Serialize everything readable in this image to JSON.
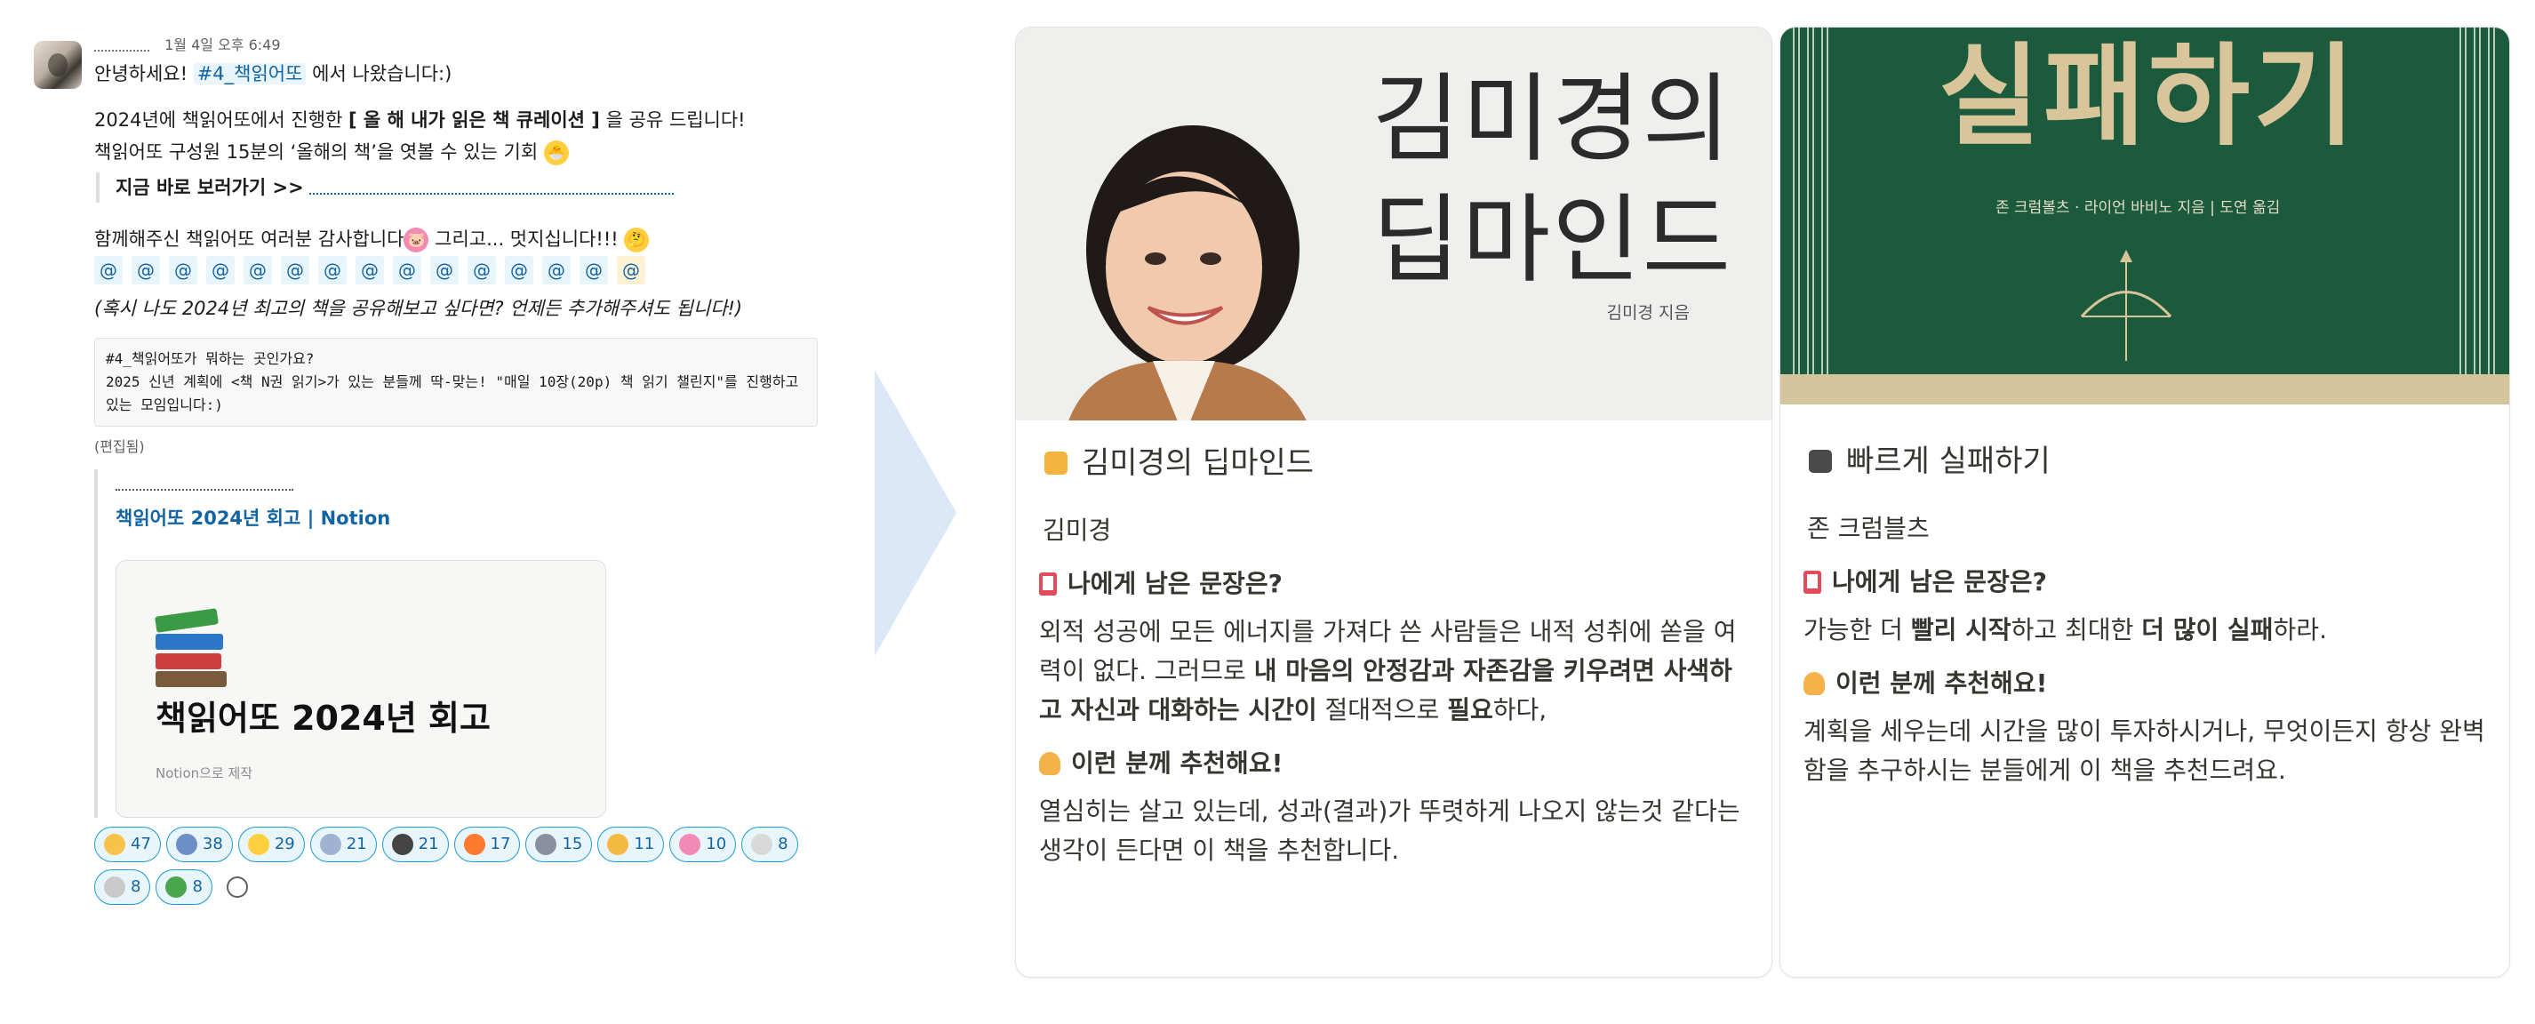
{
  "message": {
    "timestamp": "1월 4일 오후 6:49",
    "line1_pre": "안녕하세요! ",
    "line1_channel": "#4_책읽어또",
    "line1_post": " 에서 나왔습니다:)",
    "line2_pre": "2024년에 책읽어또에서 진행한 ",
    "line2_bold": "[ 올 해 내가 읽은 책 큐레이션 ]",
    "line2_post": " 을 공유 드립니다!",
    "line3": "책읽어또 구성원 15분의 ‘올해의 책’을 엿볼 수 있는 기회",
    "quote_label": "지금 바로 보러가기 >>",
    "thanks": "함께해주신 책읽어또 여러분 감사합니다",
    "thanks_post": " 그리고... 멋지십니다!!!",
    "mention_prefix": "@",
    "italic_note": "(혹시 나도 2024년 최고의 책을 공유해보고 싶다면? 언제든 추가해주셔도 됩니다!)",
    "code_text": "#4_책읽어또가 뭐하는 곳인가요?\n2025 신년 계획에 <책 N권 읽기>가 있는 분들께 딱-맞는! \"매일 10장(20p) 책 읽기 챌린지\"를 진행하고 있는 모임입니다:)",
    "edited": "(편집됨)",
    "unfurl_title": "책읽어또 2024년 회고 | Notion",
    "preview_title": "책읽어또 2024년 회고",
    "preview_sub": "Notion으로 제작",
    "reactions": [
      {
        "icon": "thumbs-up-icon",
        "color": "#f7c34a",
        "count": "47"
      },
      {
        "icon": "books-icon",
        "color": "#6d8fc7",
        "count": "38"
      },
      {
        "icon": "hatching-chick-icon",
        "color": "#ffcf3f",
        "count": "29"
      },
      {
        "icon": "open-book-icon",
        "color": "#9fb3d1",
        "count": "21"
      },
      {
        "icon": "soccer-face-icon",
        "color": "#444444",
        "count": "21"
      },
      {
        "icon": "fire-icon",
        "color": "#ff7a2f",
        "count": "17"
      },
      {
        "icon": "flexed-arm-icon",
        "color": "#8a8fa0",
        "count": "15"
      },
      {
        "icon": "muscle-icon",
        "color": "#f5b942",
        "count": "11"
      },
      {
        "icon": "pig-icon",
        "color": "#f28ab4",
        "count": "10"
      },
      {
        "icon": "tooth-icon",
        "color": "#d9d9d9",
        "count": "8"
      },
      {
        "icon": "sheep-icon",
        "color": "#c9c9c9",
        "count": "8"
      },
      {
        "icon": "clover-icon",
        "color": "#49a64f",
        "count": "8"
      }
    ]
  },
  "book1": {
    "cover_title_line1": "김미경의",
    "cover_title_line2": "딥마인드",
    "cover_author": "김미경 지음",
    "title": "김미경의 딥마인드",
    "author": "김미경",
    "q1": "나에게 남은 문장은?",
    "a1_1": "외적 성공에 모든 에너지를 가져다 쓴 사람들은 내적 성취에 쏟을 여력이 없다.  그러므로 ",
    "a1_bold1": "내 마음의 안정감과 자존감을 키우려면 사색하고 자신과 대화하는 시간이",
    "a1_2": " 절대적으로 ",
    "a1_bold2": "필요",
    "a1_3": "하다,",
    "q2": "이런 분께 추천해요!",
    "a2": "열심히는 살고 있는데, 성과(결과)가 뚜렷하게 나오지 않는것 같다는 생각이 든다면 이 책을 추천합니다."
  },
  "book2": {
    "cover_title": "실패하기",
    "cover_author": "존 크럼볼츠 · 라이언 바비노 지음  |  도연 옮김",
    "title": "빠르게 실패하기",
    "author": "존 크럼블츠",
    "q1": "나에게 남은 문장은?",
    "a1_1": "가능한 더 ",
    "a1_bold1": "빨리 시작",
    "a1_2": "하고 최대한 ",
    "a1_bold2": "더 많이 실패",
    "a1_3": "하라.",
    "q2": "이런 분께 추천해요!",
    "a2": "계획을 세우는데 시간을 많이 투자하시거나, 무엇이든지 항상 완벽함을 추구하시는 분들에게 이 책을 추천드려요."
  },
  "colors": {
    "link": "#1264a3",
    "mention_bg": "#e8f5fa",
    "cover2_green": "#1c5a3d",
    "cover2_gold": "#d8c59a"
  }
}
